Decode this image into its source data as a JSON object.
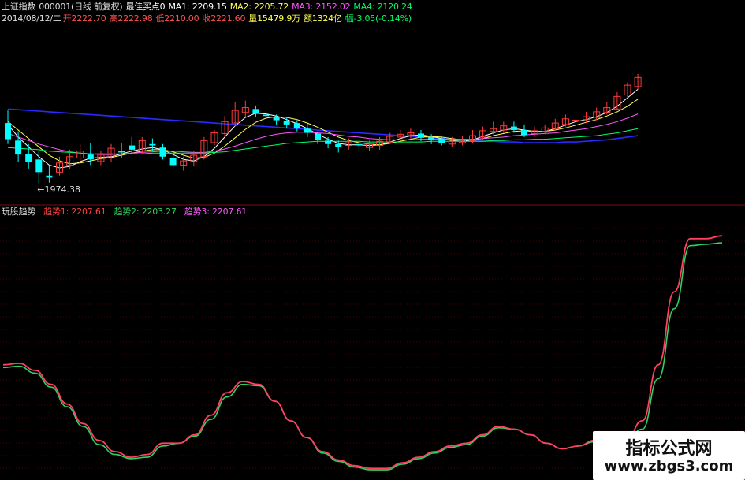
{
  "header": {
    "title": "上证指数",
    "code": "000001(日线 前复权)",
    "signal": "最佳买点0",
    "ma1": "MA1: 2209.15",
    "ma2": "MA2: 2205.72",
    "ma3": "MA3: 2152.02",
    "ma4": "MA4: 2120.24",
    "date": "2014/08/12/二",
    "open": "开2222.70",
    "high": "高2222.98",
    "low": "低2210.00",
    "close": "收2221.60",
    "volume": "量15479.9万",
    "amount": "额1324亿",
    "change": "幅-3.05(-0.14%)"
  },
  "price_panel": {
    "low_marker": "←1974.38"
  },
  "indicator": {
    "name": "玩股趋势",
    "trend1": "趋势1: 2207.61",
    "trend2": "趋势2: 2203.27",
    "trend3": "趋势3: 2207.61"
  },
  "watermark": {
    "line1": "指标公式网",
    "line2": "www.zbgs3.com"
  },
  "colors": {
    "background": "#000000",
    "up": "#ff3b3b",
    "down": "#00ffff",
    "ma1": "#ffffff",
    "ma2": "#ffff55",
    "ma3": "#ff55ff",
    "ma4": "#00ff66",
    "ma_long": "#2a2aff",
    "grid": "#4a0000",
    "separator": "#7a1010",
    "trend_red": "#ff4060",
    "trend_green": "#30d060"
  },
  "chart_data": {
    "type": "line",
    "candles": {
      "open": [
        2060,
        2035,
        2016,
        2008,
        1985,
        1990,
        2000,
        2010,
        2015,
        2005,
        2010,
        2020,
        2028,
        2020,
        2030,
        2025,
        2010,
        2000,
        2005,
        2012,
        2032,
        2045,
        2060,
        2075,
        2080,
        2072,
        2068,
        2063,
        2060,
        2052,
        2045,
        2035,
        2030,
        2028,
        2030,
        2025,
        2028,
        2033,
        2040,
        2043,
        2045,
        2040,
        2038,
        2030,
        2032,
        2035,
        2040,
        2048,
        2050,
        2055,
        2050,
        2045,
        2048,
        2052,
        2058,
        2063,
        2065,
        2068,
        2075,
        2080,
        2100,
        2112
      ],
      "close": [
        2037,
        2015,
        2005,
        1990,
        1982,
        2003,
        2012,
        2020,
        2008,
        2016,
        2024,
        2018,
        2022,
        2035,
        2028,
        2012,
        2000,
        2006,
        2014,
        2035,
        2046,
        2062,
        2078,
        2082,
        2073,
        2070,
        2064,
        2058,
        2053,
        2046,
        2036,
        2030,
        2026,
        2032,
        2028,
        2030,
        2034,
        2041,
        2044,
        2046,
        2039,
        2036,
        2031,
        2034,
        2036,
        2042,
        2049,
        2052,
        2056,
        2050,
        2043,
        2049,
        2053,
        2060,
        2066,
        2064,
        2069,
        2076,
        2082,
        2098,
        2114,
        2125
      ],
      "high": [
        2078,
        2048,
        2030,
        2020,
        2000,
        2012,
        2022,
        2030,
        2032,
        2020,
        2030,
        2032,
        2040,
        2040,
        2038,
        2030,
        2020,
        2012,
        2020,
        2040,
        2050,
        2070,
        2090,
        2092,
        2085,
        2080,
        2072,
        2068,
        2064,
        2060,
        2048,
        2040,
        2035,
        2038,
        2036,
        2035,
        2040,
        2046,
        2050,
        2052,
        2050,
        2044,
        2042,
        2040,
        2042,
        2050,
        2055,
        2062,
        2062,
        2062,
        2058,
        2055,
        2058,
        2066,
        2072,
        2070,
        2076,
        2082,
        2090,
        2104,
        2118,
        2130
      ],
      "low": [
        2030,
        2005,
        1995,
        1974.38,
        1975,
        1985,
        1995,
        2002,
        2000,
        2000,
        2005,
        2010,
        2015,
        2015,
        2020,
        2008,
        1995,
        1992,
        1998,
        2008,
        2028,
        2040,
        2055,
        2068,
        2068,
        2062,
        2058,
        2052,
        2048,
        2040,
        2030,
        2024,
        2018,
        2022,
        2020,
        2020,
        2022,
        2030,
        2035,
        2038,
        2034,
        2030,
        2028,
        2026,
        2028,
        2032,
        2036,
        2044,
        2046,
        2046,
        2040,
        2040,
        2044,
        2050,
        2055,
        2058,
        2060,
        2064,
        2072,
        2078,
        2096,
        2108
      ]
    },
    "series": [
      {
        "name": "MA1",
        "values": [
          2058,
          2040,
          2026,
          2012,
          2000,
          1996,
          1998,
          2005,
          2010,
          2011,
          2012,
          2016,
          2020,
          2023,
          2025,
          2022,
          2015,
          2008,
          2006,
          2012,
          2024,
          2040,
          2056,
          2068,
          2074,
          2073,
          2070,
          2065,
          2059,
          2052,
          2044,
          2037,
          2031,
          2029,
          2029,
          2028,
          2029,
          2033,
          2038,
          2042,
          2043,
          2041,
          2038,
          2035,
          2034,
          2036,
          2041,
          2046,
          2050,
          2052,
          2050,
          2048,
          2048,
          2052,
          2057,
          2062,
          2065,
          2069,
          2075,
          2084,
          2096,
          2108
        ]
      },
      {
        "name": "MA2",
        "values": [
          2062,
          2050,
          2038,
          2026,
          2014,
          2006,
          2002,
          2003,
          2006,
          2009,
          2011,
          2014,
          2017,
          2020,
          2022,
          2022,
          2019,
          2014,
          2010,
          2011,
          2017,
          2027,
          2039,
          2051,
          2061,
          2067,
          2069,
          2068,
          2065,
          2060,
          2054,
          2047,
          2040,
          2035,
          2032,
          2030,
          2029,
          2031,
          2034,
          2037,
          2040,
          2041,
          2040,
          2038,
          2036,
          2036,
          2038,
          2042,
          2045,
          2048,
          2049,
          2048,
          2048,
          2050,
          2053,
          2057,
          2061,
          2065,
          2070,
          2076,
          2084,
          2094
        ]
      },
      {
        "name": "MA3",
        "values": [
          2045,
          2040,
          2035,
          2030,
          2026,
          2022,
          2019,
          2017,
          2016,
          2015,
          2015,
          2016,
          2017,
          2018,
          2019,
          2020,
          2020,
          2019,
          2018,
          2018,
          2020,
          2023,
          2027,
          2032,
          2037,
          2041,
          2044,
          2046,
          2047,
          2047,
          2046,
          2045,
          2043,
          2041,
          2040,
          2038,
          2037,
          2036,
          2036,
          2036,
          2037,
          2037,
          2037,
          2037,
          2037,
          2037,
          2038,
          2039,
          2040,
          2042,
          2043,
          2044,
          2045,
          2046,
          2048,
          2050,
          2052,
          2055,
          2058,
          2062,
          2067,
          2073
        ]
      },
      {
        "name": "MA4",
        "values": [
          2025,
          2024,
          2023,
          2022,
          2020,
          2019,
          2018,
          2017,
          2016,
          2016,
          2016,
          2016,
          2016,
          2016,
          2017,
          2017,
          2017,
          2017,
          2017,
          2017,
          2018,
          2019,
          2021,
          2023,
          2025,
          2027,
          2029,
          2031,
          2032,
          2033,
          2034,
          2034,
          2034,
          2034,
          2034,
          2033,
          2033,
          2033,
          2033,
          2033,
          2033,
          2034,
          2034,
          2034,
          2034,
          2034,
          2034,
          2035,
          2035,
          2036,
          2036,
          2037,
          2037,
          2038,
          2039,
          2040,
          2041,
          2042,
          2044,
          2046,
          2049,
          2052
        ]
      }
    ],
    "ma_long": [
      2080,
      2079,
      2078,
      2077,
      2076,
      2075,
      2074,
      2073,
      2072,
      2071,
      2070,
      2069,
      2068,
      2067,
      2066,
      2065,
      2064,
      2063,
      2062,
      2061,
      2060,
      2059,
      2058,
      2057,
      2056,
      2055,
      2054,
      2053,
      2052,
      2051,
      2050,
      2049,
      2048,
      2047,
      2046,
      2045,
      2044,
      2043,
      2042,
      2041,
      2040,
      2039,
      2038,
      2037,
      2036,
      2035,
      2034,
      2034,
      2033,
      2033,
      2032,
      2032,
      2032,
      2032,
      2033,
      2033,
      2034,
      2035,
      2036,
      2038,
      2040,
      2042
    ],
    "indicator": {
      "trend1": [
        2120,
        2121,
        2116,
        2106,
        2092,
        2078,
        2066,
        2058,
        2054,
        2056,
        2064,
        2064,
        2070,
        2084,
        2100,
        2108,
        2106,
        2094,
        2080,
        2068,
        2058,
        2052,
        2048,
        2046,
        2046,
        2050,
        2054,
        2058,
        2062,
        2064,
        2070,
        2076,
        2074,
        2070,
        2064,
        2060,
        2062,
        2066,
        2068,
        2066,
        2080,
        2120,
        2172,
        2210,
        2210,
        2212
      ],
      "trend2": [
        2118,
        2119,
        2114,
        2104,
        2090,
        2076,
        2063,
        2056,
        2053,
        2054,
        2062,
        2064,
        2069,
        2081,
        2097,
        2106,
        2105,
        2094,
        2080,
        2068,
        2057,
        2051,
        2047,
        2045,
        2045,
        2049,
        2053,
        2057,
        2061,
        2063,
        2069,
        2075,
        2074,
        2070,
        2064,
        2060,
        2062,
        2065,
        2067,
        2066,
        2074,
        2110,
        2160,
        2205,
        2206,
        2207
      ]
    }
  }
}
